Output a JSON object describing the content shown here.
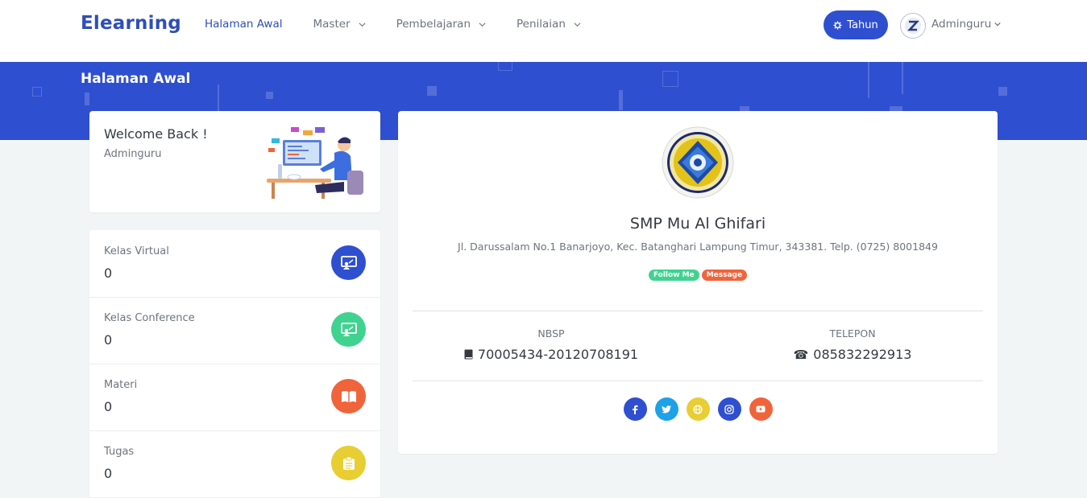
{
  "navbar": {
    "brand": "Elearning",
    "items": [
      {
        "label": "Halaman Awal",
        "active": true
      },
      {
        "label": "Master"
      },
      {
        "label": "Pembelajaran"
      },
      {
        "label": "Penilaian"
      }
    ],
    "tahun_button": "Tahun",
    "user_name": "Adminguru"
  },
  "banner": {
    "title": "Halaman Awal"
  },
  "welcome": {
    "title": "Welcome Back !",
    "subtitle": "Adminguru"
  },
  "stats": [
    {
      "label": "Kelas Virtual",
      "value": "0",
      "icon": "presentation-icon",
      "color": "#2f4fd1"
    },
    {
      "label": "Kelas Conference",
      "value": "0",
      "icon": "presentation-icon",
      "color": "#3fd38f"
    },
    {
      "label": "Materi",
      "value": "0",
      "icon": "book-icon",
      "color": "#f0643b"
    },
    {
      "label": "Tugas",
      "value": "0",
      "icon": "clipboard-icon",
      "color": "#e8cd33"
    }
  ],
  "profile": {
    "school_name": "SMP Mu Al Ghifari",
    "address": "Jl. Darussalam No.1 Banarjoyo, Kec. Batanghari Lampung Timur, 343381. Telp. (0725) 8001849",
    "badges": [
      {
        "label": "Follow Me",
        "color": "#3fd38f"
      },
      {
        "label": "Message",
        "color": "#f0643b"
      }
    ],
    "nbsp_label": "NBSP",
    "nbsp_value": "70005434-20120708191",
    "telepon_label": "TELEPON",
    "telepon_value": "085832292913",
    "socials": [
      {
        "icon": "facebook-icon",
        "color": "#2f4fd1"
      },
      {
        "icon": "twitter-icon",
        "color": "#1da1e8"
      },
      {
        "icon": "globe-icon",
        "color": "#e8cd33"
      },
      {
        "icon": "instagram-icon",
        "color": "#2f4fd1"
      },
      {
        "icon": "youtube-icon",
        "color": "#f0643b"
      }
    ]
  },
  "colors": {
    "primary": "#2f4fd1",
    "brand_text": "#2f4fb6",
    "background": "#f2f5f6"
  }
}
